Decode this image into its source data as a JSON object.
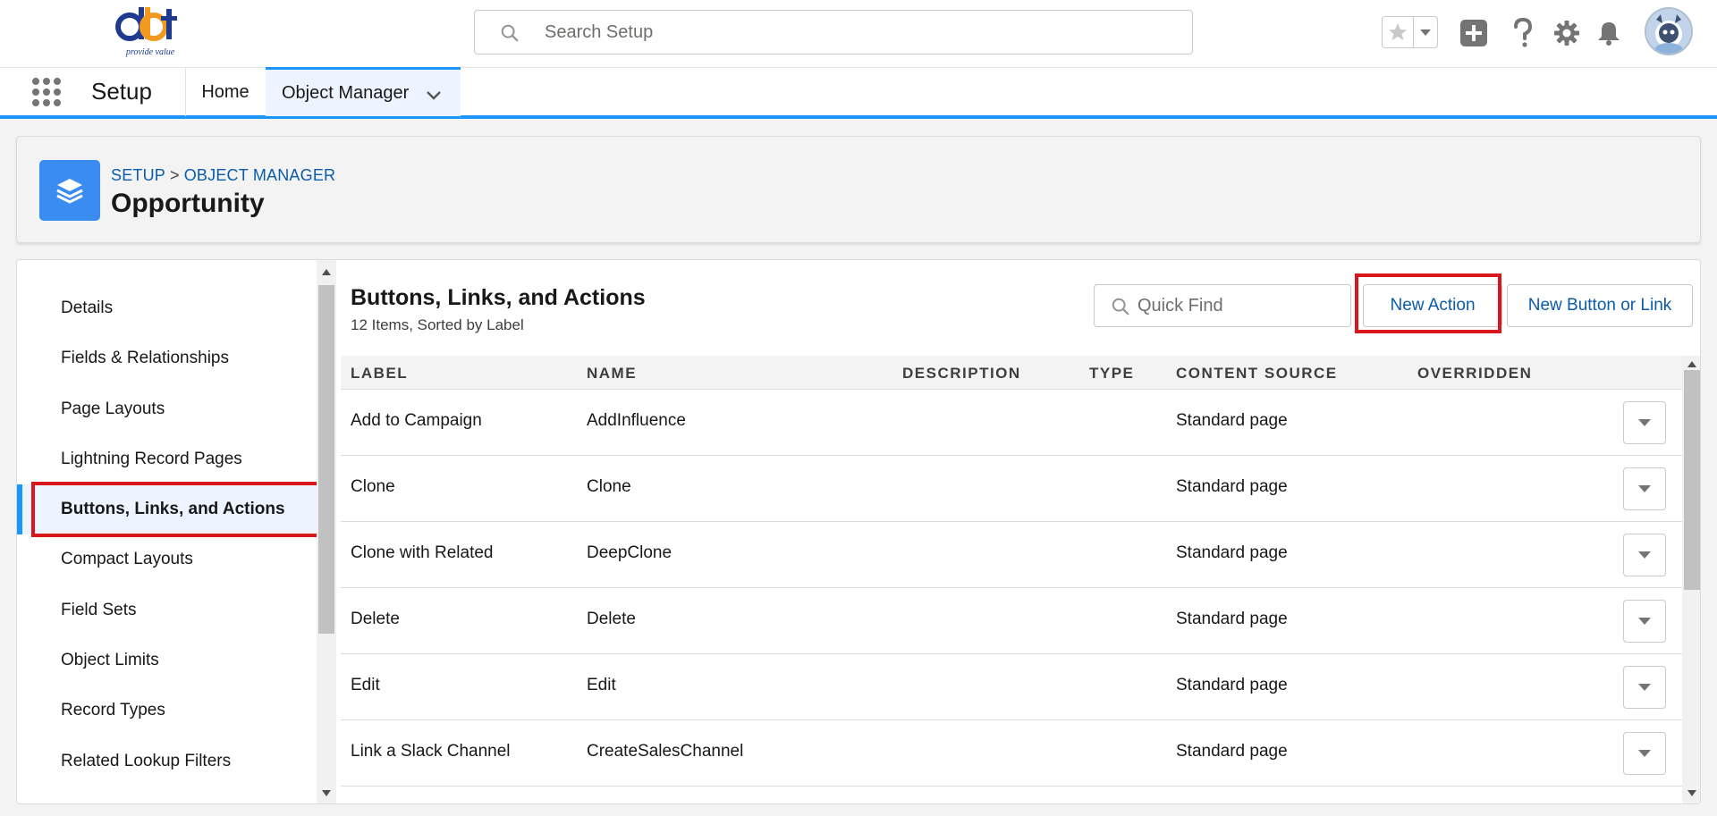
{
  "header": {
    "logo_text": "dbt",
    "logo_tagline": "provide value",
    "search_placeholder": "Search Setup"
  },
  "context_bar": {
    "app_name": "Setup",
    "tabs": [
      {
        "label": "Home"
      },
      {
        "label": "Object Manager"
      }
    ]
  },
  "page_header": {
    "breadcrumb": [
      "SETUP",
      "OBJECT MANAGER"
    ],
    "breadcrumb_separator": ">",
    "title": "Opportunity"
  },
  "left_nav": {
    "items": [
      {
        "label": "Details"
      },
      {
        "label": "Fields & Relationships"
      },
      {
        "label": "Page Layouts"
      },
      {
        "label": "Lightning Record Pages"
      },
      {
        "label": "Buttons, Links, and Actions",
        "active": true
      },
      {
        "label": "Compact Layouts"
      },
      {
        "label": "Field Sets"
      },
      {
        "label": "Object Limits"
      },
      {
        "label": "Record Types"
      },
      {
        "label": "Related Lookup Filters"
      }
    ]
  },
  "content": {
    "title": "Buttons, Links, and Actions",
    "subtitle": "12 Items, Sorted by Label",
    "quick_find_placeholder": "Quick Find",
    "new_action_label": "New Action",
    "new_button_link_label": "New Button or Link"
  },
  "table": {
    "columns": [
      "LABEL",
      "NAME",
      "DESCRIPTION",
      "TYPE",
      "CONTENT SOURCE",
      "OVERRIDDEN"
    ],
    "rows": [
      {
        "label": "Add to Campaign",
        "name": "AddInfluence",
        "description": "",
        "type": "",
        "content_source": "Standard page",
        "overridden": ""
      },
      {
        "label": "Clone",
        "name": "Clone",
        "description": "",
        "type": "",
        "content_source": "Standard page",
        "overridden": ""
      },
      {
        "label": "Clone with Related",
        "name": "DeepClone",
        "description": "",
        "type": "",
        "content_source": "Standard page",
        "overridden": ""
      },
      {
        "label": "Delete",
        "name": "Delete",
        "description": "",
        "type": "",
        "content_source": "Standard page",
        "overridden": ""
      },
      {
        "label": "Edit",
        "name": "Edit",
        "description": "",
        "type": "",
        "content_source": "Standard page",
        "overridden": ""
      },
      {
        "label": "Link a Slack Channel",
        "name": "CreateSalesChannel",
        "description": "",
        "type": "",
        "content_source": "Standard page",
        "overridden": ""
      }
    ]
  },
  "colors": {
    "brand_blue": "#1b96ff",
    "link_blue": "#0b5cab",
    "highlight_red": "#d8161b",
    "object_icon": "#3b8cf0"
  },
  "icons": {
    "search": "search-icon",
    "favorite": "star-icon",
    "add": "plus-icon",
    "help": "help-icon",
    "settings": "gear-icon",
    "notifications": "bell-icon",
    "app_launcher": "grid-icon",
    "object": "layers-icon",
    "row_menu": "chevron-down-icon"
  }
}
